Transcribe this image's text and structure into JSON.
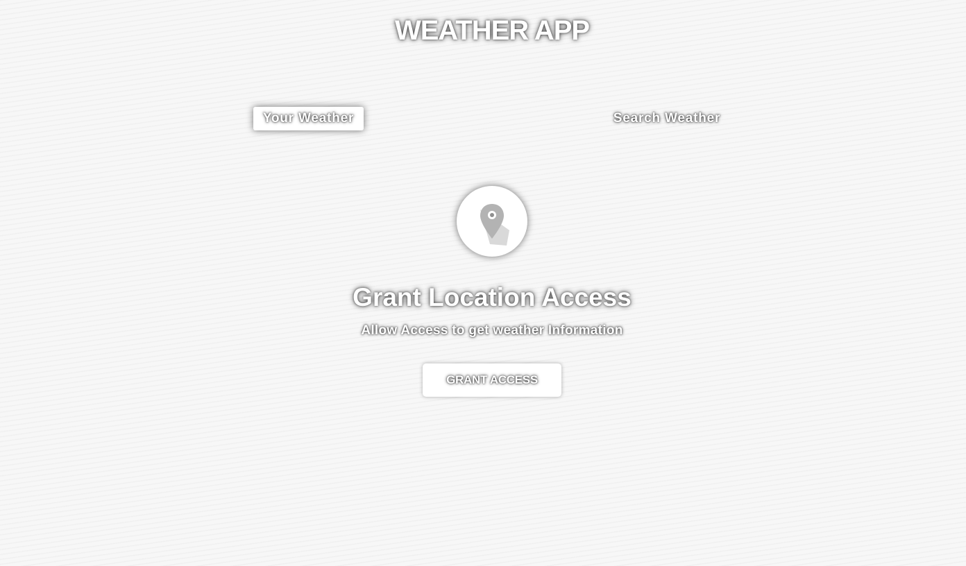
{
  "header": {
    "title": "WEATHER APP"
  },
  "tabs": [
    {
      "label": "Your Weather",
      "active": true
    },
    {
      "label": "Search Weather",
      "active": false
    }
  ],
  "grant_location": {
    "icon": "location-pin-icon",
    "title": "Grant Location Access",
    "subtitle": "Allow Access to get weather Information",
    "button_label": "GRANT ACCESS"
  },
  "colors": {
    "text": "#ffffff",
    "background": "#f7f7f7",
    "icon_pin": "#b3b3b3"
  }
}
